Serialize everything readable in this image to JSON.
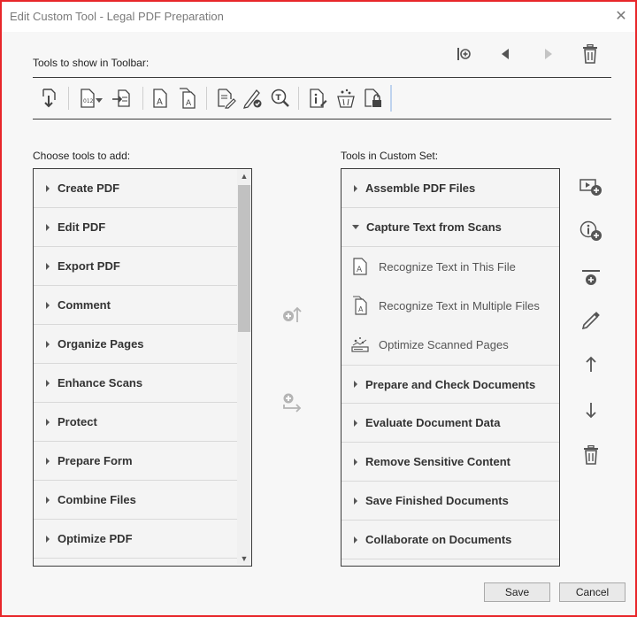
{
  "window": {
    "title": "Edit Custom Tool - Legal PDF Preparation",
    "close": "✕"
  },
  "toolbar_section": {
    "label": "Tools to show in Toolbar:",
    "nav": [
      "insert-separator-icon",
      "move-left-icon",
      "move-right-icon",
      "trash-icon"
    ],
    "icons": [
      {
        "name": "pdf-import-icon"
      },
      {
        "name": "bates-numbering-icon"
      },
      {
        "name": "insert-from-file-icon"
      },
      {
        "name": "recognize-text-icon"
      },
      {
        "name": "recognize-text-multiple-icon"
      },
      {
        "name": "edit-document-icon"
      },
      {
        "name": "sign-document-icon"
      },
      {
        "name": "text-search-icon"
      },
      {
        "name": "document-info-icon"
      },
      {
        "name": "sanitize-icon"
      },
      {
        "name": "protect-document-icon"
      }
    ]
  },
  "left_panel": {
    "label": "Choose tools to add:",
    "items": [
      "Create PDF",
      "Edit PDF",
      "Export PDF",
      "Comment",
      "Organize Pages",
      "Enhance Scans",
      "Protect",
      "Prepare Form",
      "Combine Files",
      "Optimize PDF"
    ]
  },
  "middle": {
    "add_to_set": "add-tool-icon",
    "add_group": "add-group-icon"
  },
  "right_panel": {
    "label": "Tools in Custom Set:",
    "groups": {
      "g0": "Assemble PDF Files",
      "g1": "Capture Text from Scans",
      "g2": "Prepare and Check Documents",
      "g3": "Evaluate Document Data",
      "g4": "Remove Sensitive Content",
      "g5": "Save Finished Documents",
      "g6": "Collaborate on Documents"
    },
    "subitems": [
      "Recognize Text in This File",
      "Recognize Text in Multiple Files",
      "Optimize Scanned Pages"
    ]
  },
  "side_actions": [
    "add-tool-with-video-icon",
    "add-tool-info-icon",
    "add-divider-icon",
    "rename-pencil-icon",
    "move-up-arrow-icon",
    "move-down-arrow-icon",
    "delete-trash-icon"
  ],
  "buttons": {
    "save": "Save",
    "cancel": "Cancel"
  }
}
